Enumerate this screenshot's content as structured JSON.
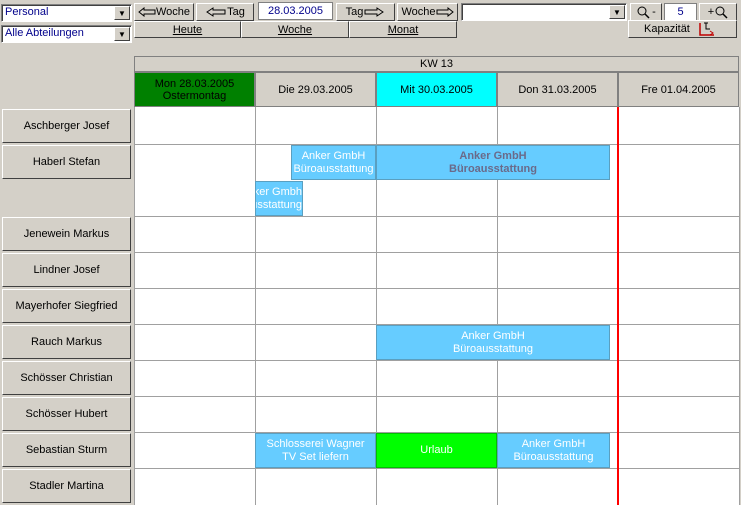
{
  "toolbar": {
    "resource_select": "Personal",
    "department_select": "Alle Abteilungen",
    "prev_week": "Woche",
    "prev_day": "Tag",
    "current_date": "28.03.2005",
    "next_day": "Tag",
    "next_week": "Woche",
    "filter_select": "",
    "zoom_out": "-",
    "zoom_value": "5",
    "zoom_in": "+",
    "view_today": "Heute",
    "view_week": "Woche",
    "view_month": "Monat",
    "capacity": "Kapazität"
  },
  "calendar": {
    "week_label": "KW 13",
    "days": [
      {
        "line1": "Mon 28.03.2005",
        "line2": "Ostermontag",
        "bg": "#008000"
      },
      {
        "line1": "Die 29.03.2005",
        "line2": "",
        "bg": "#d4d0c8"
      },
      {
        "line1": "Mit 30.03.2005",
        "line2": "",
        "bg": "#00ffff"
      },
      {
        "line1": "Don 31.03.2005",
        "line2": "",
        "bg": "#d4d0c8"
      },
      {
        "line1": "Fre 01.04.2005",
        "line2": "",
        "bg": "#d4d0c8"
      }
    ],
    "employees": [
      "Aschberger Josef",
      "Haberl Stefan",
      "Jenewein Markus",
      "Lindner Josef",
      "Mayerhofer Siegfried",
      "Rauch Markus",
      "Schösser Christian",
      "Schösser Hubert",
      "Sebastian Sturm",
      "Stadler Martina"
    ],
    "appointments": [
      {
        "line1": "Anker GmbH",
        "line2": "Büroausstattung"
      },
      {
        "line1": "Anker GmbH",
        "line2": "Büroausstattung"
      },
      {
        "line1": "Anker Gmbh",
        "line2": "Büroausstattung"
      },
      {
        "line1": "Anker GmbH",
        "line2": "Büroausstattung"
      },
      {
        "line1": "Schlosserei Wagner",
        "line2": "TV Set liefern"
      },
      {
        "line1": "Urlaub",
        "line2": ""
      },
      {
        "line1": "Anker GmbH",
        "line2": "Büroausstattung"
      }
    ]
  },
  "colors": {
    "appointment": "#66ccff",
    "vacation": "#00ff00",
    "today_marker": "#ff0000",
    "holiday": "#008000",
    "current_day": "#00ffff"
  }
}
